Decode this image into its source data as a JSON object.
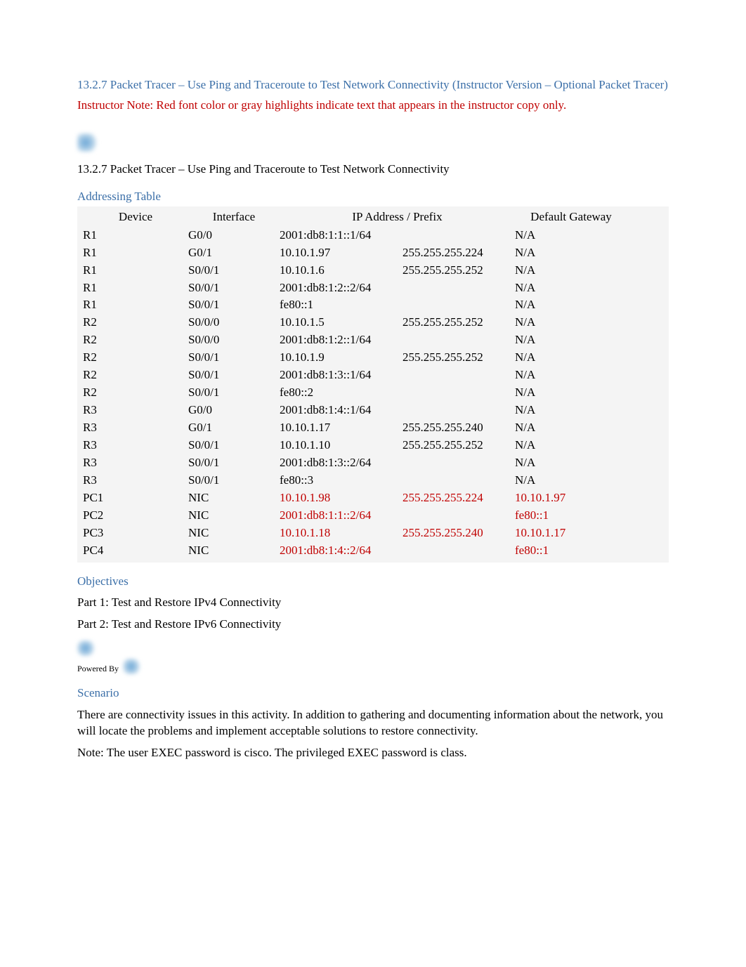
{
  "title": {
    "line1": "13.2.7 Packet Tracer – Use Ping and Traceroute to Test Network Connectivity (Instructor Version – Optional Packet Tracer)",
    "instructor_label": "Instructor Note:",
    "instructor_body": " Red font color or gray highlights indicate text that appears in the instructor copy only."
  },
  "subtitle": "13.2.7 Packet Tracer – Use Ping and Traceroute to Test Network Connectivity",
  "table_heading": "Addressing Table",
  "headers": {
    "device": "Device",
    "interface": "Interface",
    "ip_prefix": "IP Address / Prefix",
    "gateway": "Default Gateway"
  },
  "rows": [
    {
      "device": "R1",
      "interface": "G0/0",
      "ip": "2001:db8:1:1::1/64",
      "mask": "",
      "gw": "N/A",
      "red": false
    },
    {
      "device": "R1",
      "interface": "G0/1",
      "ip": "10.10.1.97",
      "mask": "255.255.255.224",
      "gw": "N/A",
      "red": false
    },
    {
      "device": "R1",
      "interface": "S0/0/1",
      "ip": "10.10.1.6",
      "mask": "255.255.255.252",
      "gw": "N/A",
      "red": false
    },
    {
      "device": "R1",
      "interface": "S0/0/1",
      "ip": "2001:db8:1:2::2/64",
      "mask": "",
      "gw": "N/A",
      "red": false
    },
    {
      "device": "R1",
      "interface": "S0/0/1",
      "ip": "fe80::1",
      "mask": "",
      "gw": "N/A",
      "red": false
    },
    {
      "device": "R2",
      "interface": "S0/0/0",
      "ip": "10.10.1.5",
      "mask": "255.255.255.252",
      "gw": "N/A",
      "red": false
    },
    {
      "device": "R2",
      "interface": "S0/0/0",
      "ip": "2001:db8:1:2::1/64",
      "mask": "",
      "gw": "N/A",
      "red": false
    },
    {
      "device": "R2",
      "interface": "S0/0/1",
      "ip": "10.10.1.9",
      "mask": "255.255.255.252",
      "gw": "N/A",
      "red": false
    },
    {
      "device": "R2",
      "interface": "S0/0/1",
      "ip": "2001:db8:1:3::1/64",
      "mask": "",
      "gw": "N/A",
      "red": false
    },
    {
      "device": "R2",
      "interface": "S0/0/1",
      "ip": "fe80::2",
      "mask": "",
      "gw": "N/A",
      "red": false
    },
    {
      "device": "R3",
      "interface": "G0/0",
      "ip": "2001:db8:1:4::1/64",
      "mask": "",
      "gw": "N/A",
      "red": false
    },
    {
      "device": "R3",
      "interface": "G0/1",
      "ip": "10.10.1.17",
      "mask": "255.255.255.240",
      "gw": "N/A",
      "red": false
    },
    {
      "device": "R3",
      "interface": "S0/0/1",
      "ip": "10.10.1.10",
      "mask": "255.255.255.252",
      "gw": "N/A",
      "red": false
    },
    {
      "device": "R3",
      "interface": "S0/0/1",
      "ip": "2001:db8:1:3::2/64",
      "mask": "",
      "gw": "N/A",
      "red": false
    },
    {
      "device": "R3",
      "interface": "S0/0/1",
      "ip": "fe80::3",
      "mask": "",
      "gw": "N/A",
      "red": false
    },
    {
      "device": "PC1",
      "interface": "NIC",
      "ip": "10.10.1.98",
      "mask": "255.255.255.224",
      "gw": "10.10.1.97",
      "red": true
    },
    {
      "device": "PC2",
      "interface": "NIC",
      "ip": "2001:db8:1:1::2/64",
      "mask": "",
      "gw": "fe80::1",
      "red": true
    },
    {
      "device": "PC3",
      "interface": "NIC",
      "ip": "10.10.1.18",
      "mask": "255.255.255.240",
      "gw": "10.10.1.17",
      "red": true
    },
    {
      "device": "PC4",
      "interface": "NIC",
      "ip": "2001:db8:1:4::2/64",
      "mask": "",
      "gw": "fe80::1",
      "red": true
    }
  ],
  "objectives": {
    "heading": "Objectives",
    "part1": "Part 1: Test and Restore IPv4 Connectivity",
    "part2": "Part 2: Test and Restore IPv6 Connectivity"
  },
  "powered_by": "Powered By",
  "scenario": {
    "heading": "Scenario",
    "body": "There are connectivity issues in this activity. In addition to gathering and documenting information about the network, you will locate the problems and implement acceptable solutions to restore connectivity.",
    "note_prefix": "Note",
    "note_body_1": ": The user EXEC password is ",
    "note_pw1": "cisco",
    "note_body_2": ". The privileged EXEC password is ",
    "note_pw2": "class",
    "note_body_3": "."
  }
}
